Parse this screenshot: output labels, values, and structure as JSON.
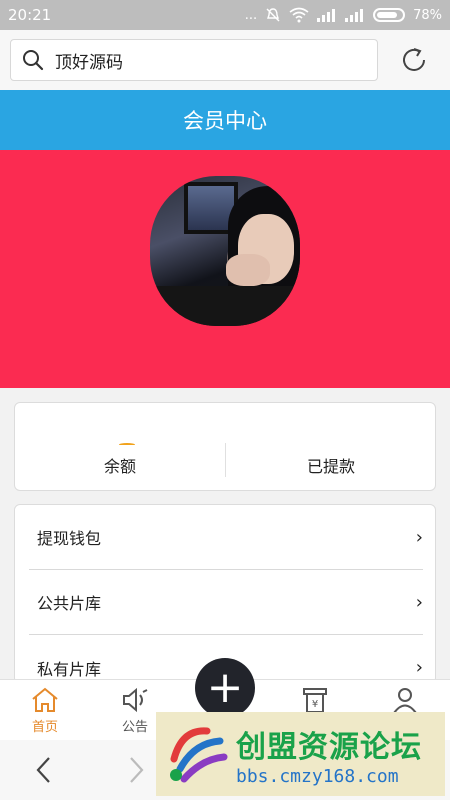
{
  "status": {
    "time": "20:21",
    "dots": "...",
    "battery": "78%"
  },
  "search": {
    "query": "顶好源码"
  },
  "header": {
    "title": "会员中心"
  },
  "balance": {
    "left_label": "余额",
    "right_label": "已提款"
  },
  "menu": [
    {
      "label": "提现钱包"
    },
    {
      "label": "公共片库"
    },
    {
      "label": "私有片库"
    }
  ],
  "tabs": [
    {
      "label": "首页",
      "icon": "home-icon",
      "active": true
    },
    {
      "label": "公告",
      "icon": "speaker-icon",
      "active": false
    },
    {
      "label": "",
      "icon": "receipt-icon",
      "active": false
    },
    {
      "label": "",
      "icon": "user-icon",
      "active": false
    }
  ],
  "watermark": {
    "title": "创盟资源论坛",
    "url": "bbs.cmzy168.com"
  },
  "colors": {
    "title_bar": "#2aa5e2",
    "hero": "#fb2b51",
    "active_tab": "#e58a2c"
  }
}
